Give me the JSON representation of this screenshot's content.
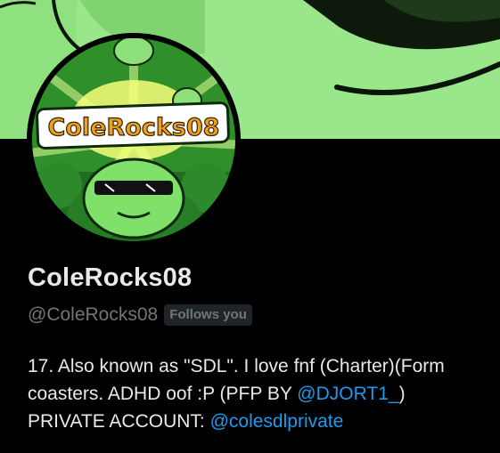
{
  "profile": {
    "display_name": "ColeRocks08",
    "handle": "@ColeRocks08",
    "follows_you_badge": "Follows you",
    "avatar_text": "ColeRocks08",
    "bio": {
      "line1_text": "17. Also known as \"SDL\". I love fnf (Charter)(Form",
      "line2_text": "coasters. ADHD oof :P (PFP BY ",
      "line2_mention": "@DJORT1_",
      "line2_suffix": ")",
      "line3_text": "PRIVATE ACCOUNT: ",
      "line3_mention": "@colesdlprivate"
    }
  },
  "colors": {
    "background": "#000000",
    "text_primary": "#e7e9ea",
    "text_secondary": "#71767b",
    "link": "#1d9bf0",
    "banner_green": "#8fe07f",
    "badge_bg": "#202327"
  },
  "icons": {
    "banner": "green-character-banner",
    "avatar": "colerocks08-logo-avatar"
  }
}
